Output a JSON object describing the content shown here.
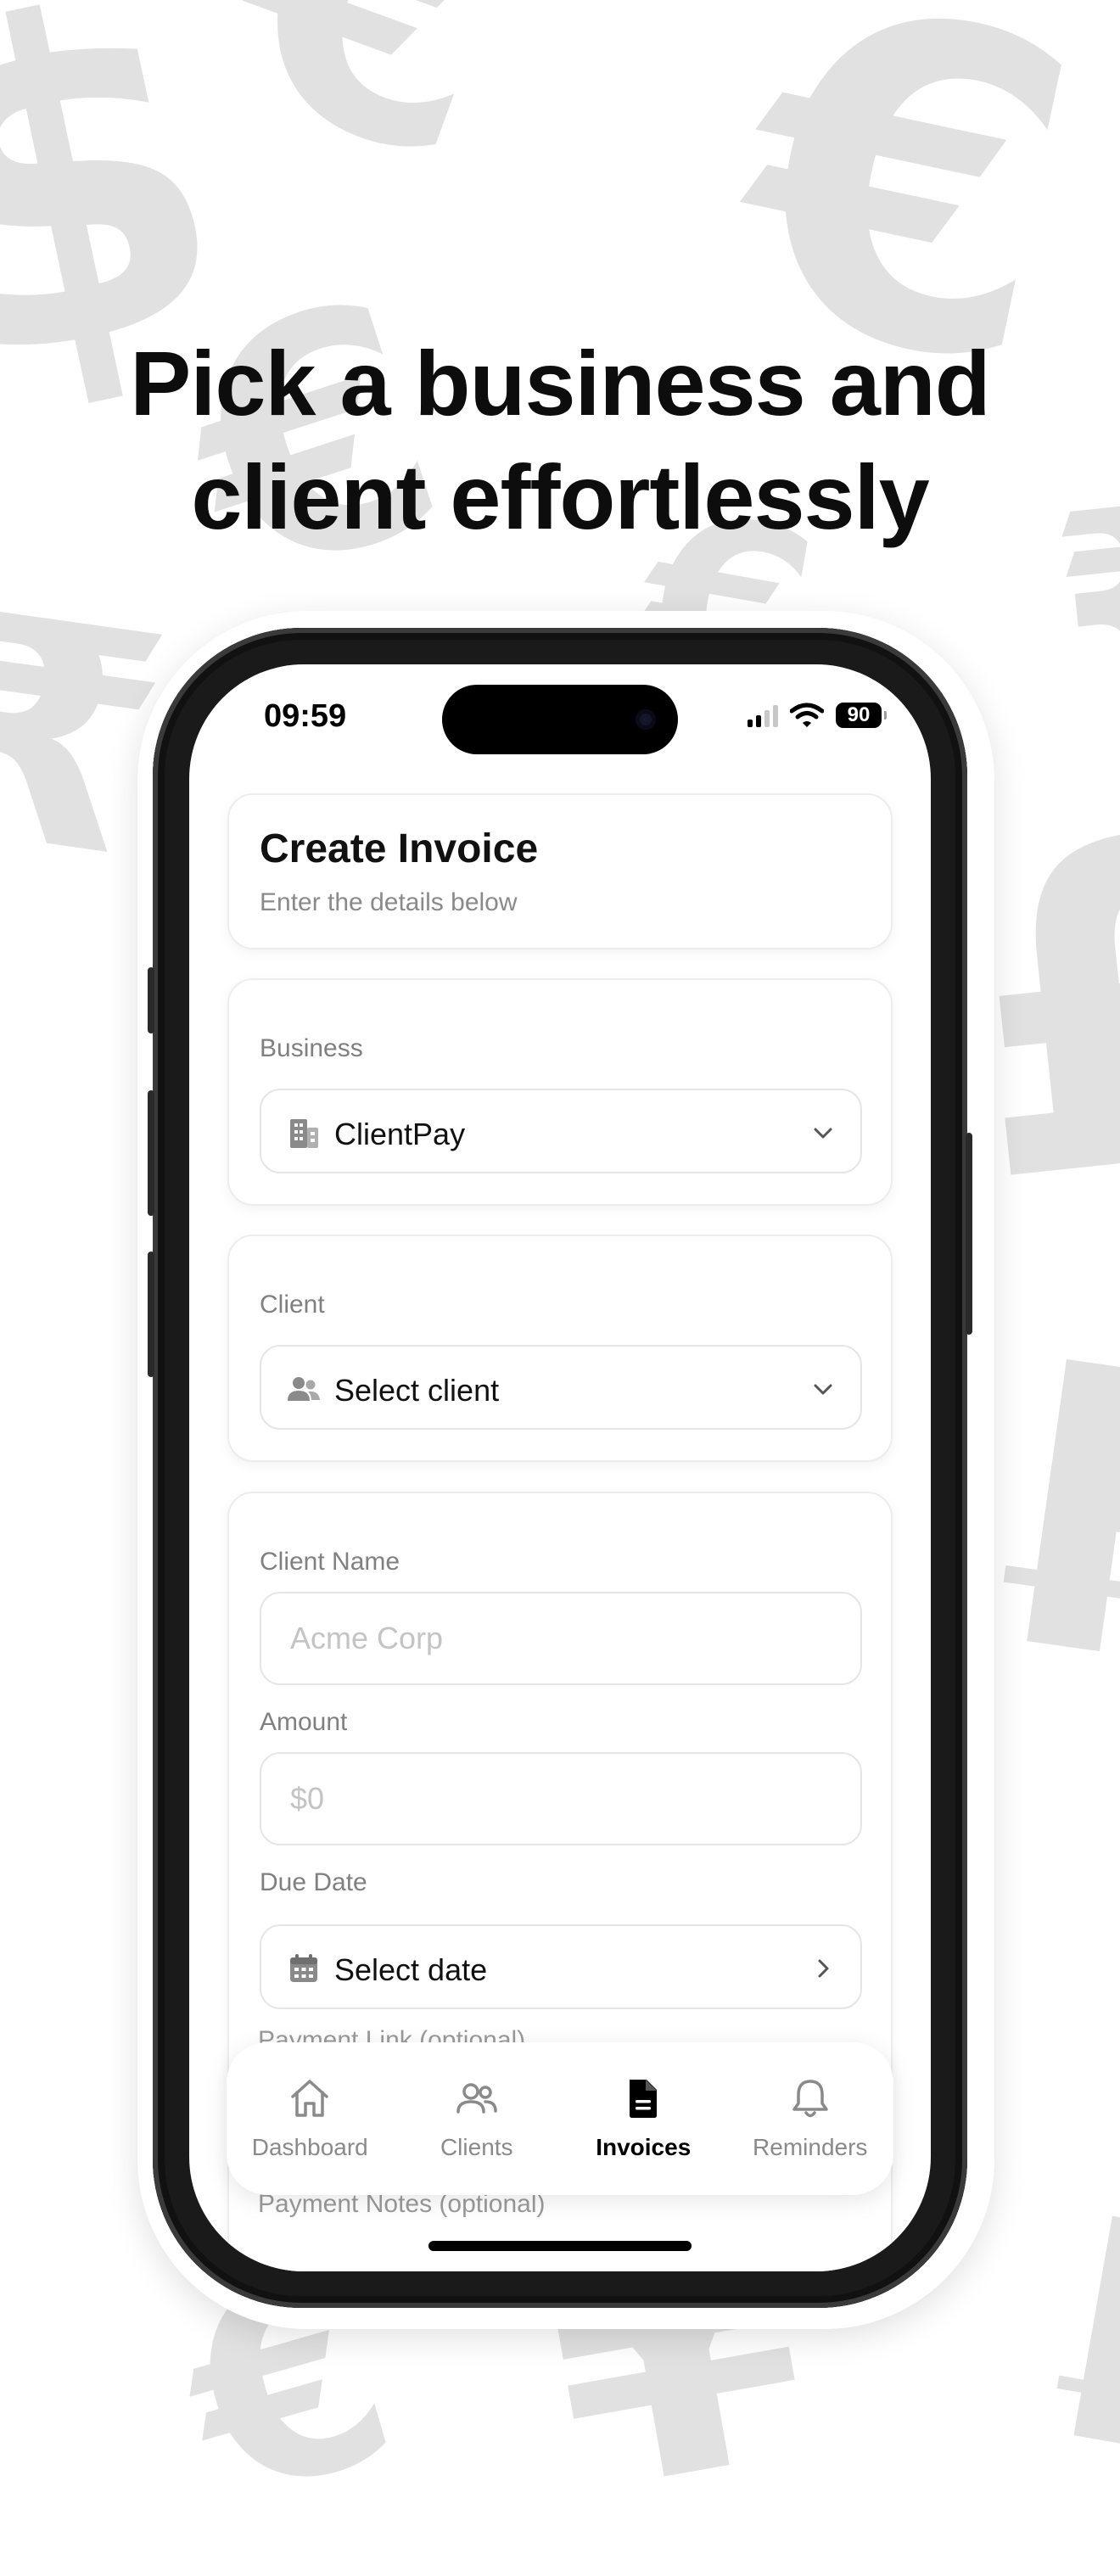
{
  "marketing": {
    "headline_line1": "Pick a business and",
    "headline_line2": "client effortlessly",
    "background_symbols": [
      "$",
      "€",
      "€",
      "€",
      "€",
      "₹",
      "₹",
      "£",
      "₣",
      "¥",
      "₣",
      "€"
    ]
  },
  "status_bar": {
    "time": "09:59",
    "battery_level": "90",
    "signal": "signal-bars-icon",
    "wifi": "wifi-icon"
  },
  "header_card": {
    "title": "Create Invoice",
    "subtitle": "Enter the details below"
  },
  "business_card": {
    "label": "Business",
    "selected": "ClientPay",
    "icon": "building-icon"
  },
  "client_card": {
    "label": "Client",
    "selected": "Select client",
    "icon": "users-icon"
  },
  "details_card": {
    "client_name_label": "Client Name",
    "client_name_placeholder": "Acme Corp",
    "client_name_value": "",
    "amount_label": "Amount",
    "amount_placeholder": "$0",
    "amount_value": "",
    "due_date_label": "Due Date",
    "due_date_value": "Select date",
    "payment_link_label": "Payment Link (optional)",
    "payment_notes_label": "Payment Notes (optional)"
  },
  "tabs": [
    {
      "label": "Dashboard",
      "icon": "home-icon",
      "active": false
    },
    {
      "label": "Clients",
      "icon": "users-icon",
      "active": false
    },
    {
      "label": "Invoices",
      "icon": "document-icon",
      "active": true
    },
    {
      "label": "Reminders",
      "icon": "bell-icon",
      "active": false
    }
  ],
  "colors": {
    "background_symbol": "#e1e1e1",
    "text_primary": "#111111",
    "text_secondary": "#8a8a8a",
    "border": "#e6e6e6",
    "tab_active": "#000000",
    "tab_inactive": "#8a8a8a"
  }
}
